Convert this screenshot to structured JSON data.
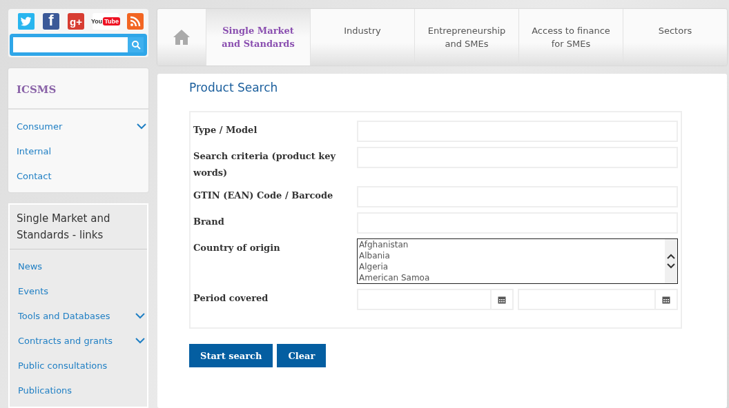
{
  "social": [
    {
      "kind": "twitter"
    },
    {
      "kind": "facebook",
      "glyph": "f"
    },
    {
      "kind": "gplus",
      "glyph": "g+"
    },
    {
      "kind": "youtube",
      "glyph": "You",
      "glyph2": "Tube"
    },
    {
      "kind": "rss"
    }
  ],
  "nav": {
    "tabs": [
      {
        "label": "Single Market and Standards",
        "selected": true
      },
      {
        "label": "Industry",
        "selected": false
      },
      {
        "label": "Entrepreneurship and SMEs",
        "selected": false
      },
      {
        "label": "Access to finance for SMEs",
        "selected": false
      },
      {
        "label": "Sectors",
        "selected": false
      }
    ]
  },
  "sidebar": {
    "title": "ICSMS",
    "items": [
      {
        "label": "Consumer",
        "has_submenu": true
      },
      {
        "label": "Internal",
        "has_submenu": false
      },
      {
        "label": "Contact",
        "has_submenu": false
      }
    ]
  },
  "links": {
    "title": "Single Market and Standards - links",
    "items": [
      {
        "label": "News",
        "has_submenu": false
      },
      {
        "label": "Events",
        "has_submenu": false
      },
      {
        "label": "Tools and Databases",
        "has_submenu": true
      },
      {
        "label": "Contracts and grants",
        "has_submenu": true
      },
      {
        "label": "Public consultations",
        "has_submenu": false
      },
      {
        "label": "Publications",
        "has_submenu": false
      }
    ]
  },
  "form": {
    "title": "Product Search",
    "fields": [
      {
        "label": "Type / Model",
        "kind": "text"
      },
      {
        "label": "Search criteria (product key words)",
        "kind": "text"
      },
      {
        "label": "GTIN (EAN) Code / Barcode",
        "kind": "text"
      },
      {
        "label": "Brand",
        "kind": "text"
      },
      {
        "label": "Country of origin",
        "kind": "list",
        "options": [
          "Afghanistan",
          "Albania",
          "Algeria",
          "American Samoa"
        ]
      },
      {
        "label": "Period covered",
        "kind": "dates"
      }
    ],
    "buttons": [
      "Start search",
      "Clear"
    ]
  }
}
